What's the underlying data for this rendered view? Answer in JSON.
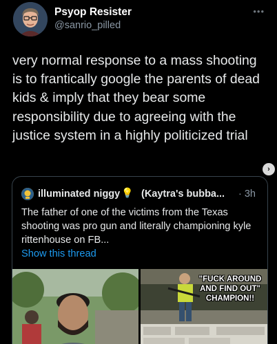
{
  "author": {
    "display_name": "Psyop Resister",
    "handle": "@sanrio_pilled",
    "avatar_icon": "avatar-man-glasses"
  },
  "more_icon": "•••",
  "tweet": {
    "text": "very normal response to a mass shooting is to frantically google the parents of dead kids & imply that they bear some responsibility due to agreeing with the justice system in a highly politicized trial"
  },
  "scroll_arrow": "›",
  "quoted": {
    "name": "illuminated niggy",
    "emoji": "💡",
    "subtitle": "(Kaytra's bubba...",
    "time": "· 3h",
    "text": "The father of one of the victims from the Texas shooting was pro gun and literally championing kyle rittenhouse on FB...",
    "show_thread": "Show this thread",
    "images": {
      "right_overlay": "\"FUCK AROUND AND FIND OUT\" CHAMPION!!"
    }
  },
  "colors": {
    "background": "#000000",
    "text": "#e7e9ea",
    "secondary": "#8b98a5",
    "link": "#1d9bf0",
    "border": "#38444d"
  }
}
